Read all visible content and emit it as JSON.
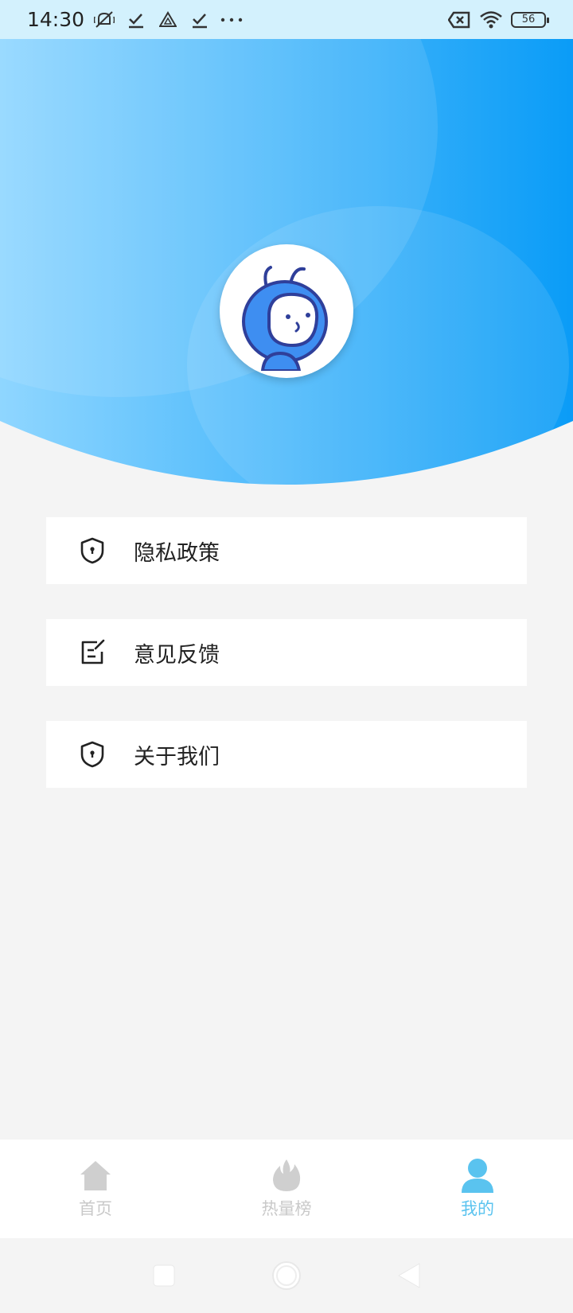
{
  "status_bar": {
    "time": "14:30",
    "icons": [
      "mute-icon",
      "check-icon",
      "drive-icon",
      "check-icon",
      "more-dots-icon"
    ],
    "battery": "56",
    "right_icons": [
      "no-sim-icon",
      "wifi-icon",
      "battery-icon"
    ]
  },
  "header": {
    "gradient_start": "#8fd6ff",
    "gradient_end": "#0a9cf7",
    "avatar_icon": "robot-mascot-avatar"
  },
  "menu": {
    "items": [
      {
        "label": "隐私政策",
        "icon": "shield-lock-icon"
      },
      {
        "label": "意见反馈",
        "icon": "edit-note-icon"
      },
      {
        "label": "关于我们",
        "icon": "shield-lock-icon"
      }
    ]
  },
  "bottom_nav": {
    "items": [
      {
        "label": "首页",
        "icon": "home-icon",
        "active": false
      },
      {
        "label": "热量榜",
        "icon": "flame-icon",
        "active": false
      },
      {
        "label": "我的",
        "icon": "person-icon",
        "active": true
      }
    ],
    "active_color": "#5ac3ef",
    "inactive_color": "#c9c9c9"
  },
  "system_nav": [
    "recent-apps-icon",
    "home-circle-icon",
    "back-triangle-icon"
  ]
}
